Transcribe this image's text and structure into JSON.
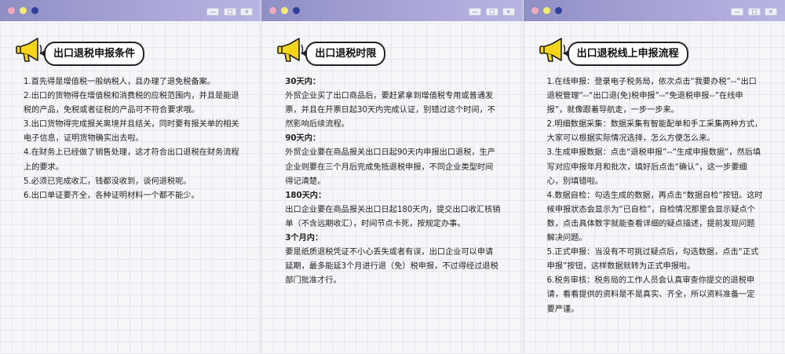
{
  "colors": {
    "titlebar": "#9c9ad1",
    "dot_pink": "#f0a7bd",
    "dot_yellow": "#f3ea72",
    "dot_navy": "#2f3f9b",
    "horn": "#f7d51a"
  },
  "window_buttons": [
    "—",
    "□",
    "×"
  ],
  "panels": [
    {
      "title": "出口退税申报条件",
      "icon": "megaphone-icon",
      "paragraphs": [
        "1.首先得是增值税一般纳税人，且办理了退免税备案。",
        "2.出口的货物得在增值税和消费税的应税范围内，并且是能退税的产品，免税或者征税的产品可不符合要求哦。",
        "3.出口货物得完成报关离境并且结关，同时要有报关单的相关电子信息，证明货物确实出去啦。",
        "4.在财务上已经做了销售处理，这才符合出口退税在财务流程上的要求。",
        "5.必须已完成收汇，钱都没收到，谈何退税呢。",
        "6.出口单证要齐全，各种证明材料一个都不能少。"
      ]
    },
    {
      "title": "出口退税时限",
      "icon": "megaphone-icon",
      "sections": [
        {
          "heading": "30天内：",
          "text": "外贸企业买了出口商品后，要赶紧拿到增值税专用或普通发票，并且在开票日起30天内完成认证，别错过这个时间，不然影响后续流程。"
        },
        {
          "heading": "90天内：",
          "text": "外贸企业要在商品报关出口日起90天内申报出口退税，生产企业则要在三个月后完成免抵退税申报，不同企业类型时间得记清楚。"
        },
        {
          "heading": "180天内：",
          "text": "出口企业要在商品报关出口日起180天内，提交出口收汇核销单（不含远期收汇），时间节点卡死，按规定办事。"
        },
        {
          "heading": "3个月内：",
          "text": "要是纸质退税凭证不小心丢失或者有误，出口企业可以申请延期，最多能延3个月进行退（免）税申报，不过得经过退税部门批准才行。"
        }
      ]
    },
    {
      "title": "出口退税线上申报流程",
      "icon": "megaphone-icon",
      "paragraphs": [
        "1.在线申报：登录电子税务局，依次点击“我要办税”--“出口退税管理”--“出口退(免)税申报”--“免退税申报--”在线申报”，就像跟着导航走，一步一步来。",
        "2.明细数据采集：数据采集有智能配单和手工采集两种方式，大家可以根据实际情况选择，怎么方便怎么来。",
        "3.生成申报数据：点击“退税申报”--“生成申报数据”，然后填写对应申报年月和批次，填好后点击“确认”，这一步要细心，别填错啦。",
        "4.数据自检：勾选生成的数据，再点击“数据自检”按钮。这时候申报状态会显示为“已自检”，自检情况那里会显示疑点个数，点击具体数字就能查看详细的疑点描述，提前发现问题解决问题。",
        "5.正式申报：当没有不可挑过疑点后，勾选数据，点击“正式申报”按钮，这样数据就转为正式申报啦。",
        "6.税务审核：税务局的工作人员会认真审查你提交的退税申请，看看提供的资料是不是真实、齐全，所以资料准备一定要严谨。"
      ]
    }
  ]
}
